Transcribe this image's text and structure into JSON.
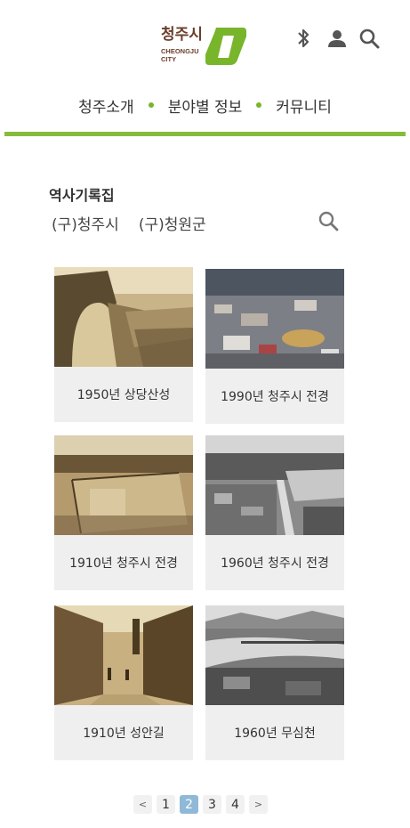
{
  "logo": {
    "title": "청주시",
    "en_line1": "CHEONGJU",
    "en_line2": "CITY"
  },
  "header_icons": [
    "bluetooth-icon",
    "user-icon",
    "search-icon"
  ],
  "nav": {
    "items": [
      "청주소개",
      "분야별 정보",
      "커뮤니티"
    ]
  },
  "colors": {
    "accent": "#86bc3b",
    "dot": "#78b52b",
    "logo_brown": "#6b3e2a",
    "pager_active": "#8fb9d6"
  },
  "section": {
    "title": "역사기록집",
    "tabs": [
      "(구)청주시",
      "(구)청원군"
    ]
  },
  "cards": [
    {
      "caption": "1950년 상당산성"
    },
    {
      "caption": "1990년 청주시 전경"
    },
    {
      "caption": "1910년 청주시 전경"
    },
    {
      "caption": "1960년 청주시 전경"
    },
    {
      "caption": "1910년 성안길"
    },
    {
      "caption": "1960년 무심천"
    }
  ],
  "pagination": {
    "prev": "<",
    "pages": [
      "1",
      "2",
      "3",
      "4"
    ],
    "current": "2",
    "next": ">"
  }
}
